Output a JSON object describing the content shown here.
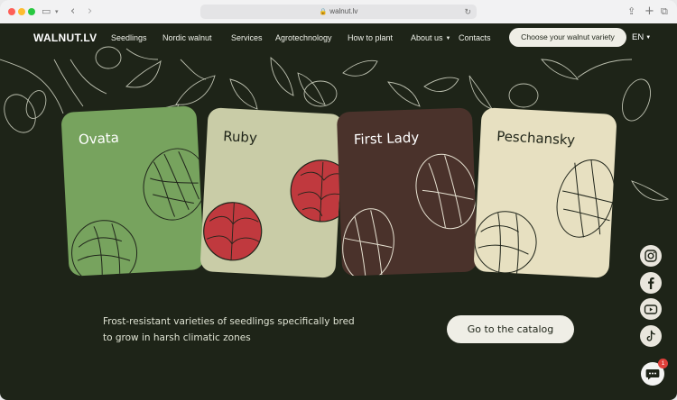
{
  "browser": {
    "url": "walnut.lv",
    "icons": [
      "sidebar-icon",
      "chevron-down-icon",
      "back-icon",
      "forward-icon",
      "lock-icon",
      "reload-icon",
      "share-icon",
      "new-tab-icon",
      "tabs-icon"
    ]
  },
  "nav": {
    "logo": "WALNUT.LV",
    "items": [
      {
        "label": "Seedlings"
      },
      {
        "label": "Nordic walnut"
      },
      {
        "label": "Services"
      },
      {
        "label": "Agrotechnology"
      },
      {
        "label": "How to plant"
      },
      {
        "label": "About us"
      },
      {
        "label": "Contacts"
      }
    ],
    "cta": "Choose your walnut variety",
    "language": "EN"
  },
  "cards": [
    {
      "title": "Ovata",
      "color": "#77a35e"
    },
    {
      "title": "Ruby",
      "color": "#c9cca7"
    },
    {
      "title": "First Lady",
      "color": "#4a322b"
    },
    {
      "title": "Peschansky",
      "color": "#e7e0c1"
    }
  ],
  "hero": {
    "tagline": "Frost-resistant varieties of seedlings specifically bred to grow in harsh climatic zones",
    "catalog_button": "Go to the catalog"
  },
  "social": [
    "instagram-icon",
    "facebook-icon",
    "youtube-icon",
    "tiktok-icon"
  ],
  "chat": {
    "badge": "1"
  },
  "colors": {
    "background": "#1e2418",
    "light": "#efeee6",
    "ruby_kernel": "#c0393e"
  }
}
